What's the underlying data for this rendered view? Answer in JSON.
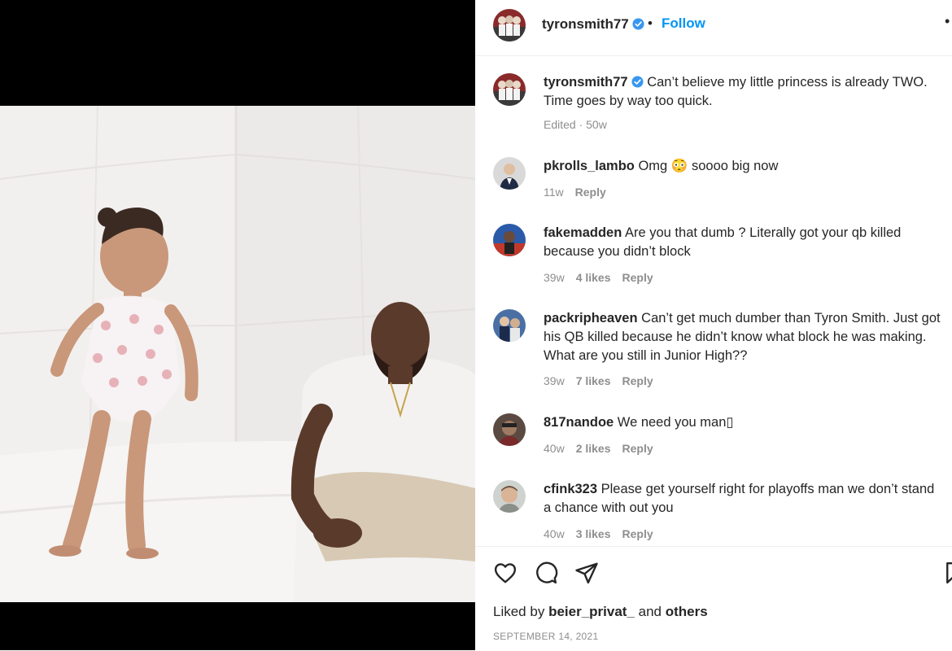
{
  "post": {
    "author": "tyronsmith77",
    "follow_label": "Follow",
    "separator": "•",
    "more_label": "•",
    "caption_text": "Can’t believe my little princess is already TWO. Time goes by way too quick.",
    "caption_meta": "Edited · 50w"
  },
  "comments": [
    {
      "user": "pkrolls_lambo",
      "text": "Omg",
      "text_after_emoji": "soooo big now",
      "emoji": "😳",
      "age": "11w",
      "likes": "",
      "reply": "Reply"
    },
    {
      "user": "fakemadden",
      "text": "Are you that dumb ? Literally got your qb killed because you didn’t block",
      "age": "39w",
      "likes": "4 likes",
      "reply": "Reply"
    },
    {
      "user": "packripheaven",
      "text": "Can’t get much dumber than Tyron Smith. Just got his QB killed because he didn’t know what block he was making. What are you still in Junior High??",
      "age": "39w",
      "likes": "7 likes",
      "reply": "Reply"
    },
    {
      "user": "817nandoe",
      "text": "We need you man▯",
      "age": "40w",
      "likes": "2 likes",
      "reply": "Reply"
    },
    {
      "user": "cfink323",
      "text": "Please get yourself right for playoffs man we don’t stand a chance with out you",
      "age": "40w",
      "likes": "3 likes",
      "reply": "Reply"
    }
  ],
  "footer": {
    "liked_prefix": "Liked by",
    "liked_user": "beier_privat_",
    "liked_and": "and",
    "liked_others": "others",
    "date": "SEPTEMBER 14, 2021"
  },
  "icons": {
    "like": "heart-icon",
    "comment": "comment-bubble-icon",
    "share": "paper-plane-icon",
    "save": "bookmark-icon"
  },
  "colors": {
    "accent": "#0095f6",
    "muted": "#8e8e8e",
    "text": "#262626",
    "verified": "#3897f0"
  }
}
